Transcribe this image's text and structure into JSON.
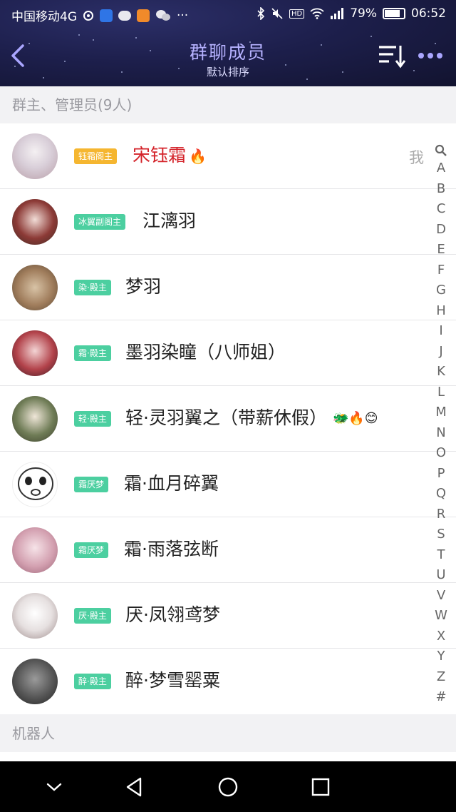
{
  "status": {
    "carrier": "中国移动4G",
    "battery": "79%",
    "battery_level": 0.79,
    "time": "06:52",
    "more": "···"
  },
  "header": {
    "title": "群聊成员",
    "subtitle": "默认排序"
  },
  "sections": {
    "admins": "群主、管理员(9人)",
    "robots": "机器人"
  },
  "members": [
    {
      "badge": "钰霜阁主",
      "badge_color": "#f5b630",
      "name": "宋钰霜",
      "name_color": "#d4232a",
      "emoji": "🔥",
      "me_label": "我"
    },
    {
      "badge": "冰翼副阁主",
      "badge_color": "#4ccfa0",
      "name": "江漓羽"
    },
    {
      "badge": "染·殿主",
      "badge_color": "#4ccfa0",
      "name": "梦羽"
    },
    {
      "badge": "霜·殿主",
      "badge_color": "#4ccfa0",
      "name": "墨羽染瞳（八师姐）"
    },
    {
      "badge": "轻·殿主",
      "badge_color": "#4ccfa0",
      "name": "轻·灵羽翼之（带薪休假）",
      "emoji": "🐲🔥😊"
    },
    {
      "badge": "霜厌梦",
      "badge_color": "#4ccfa0",
      "name": "霜·血月碎翼"
    },
    {
      "badge": "霜厌梦",
      "badge_color": "#4ccfa0",
      "name": "霜·雨落弦断"
    },
    {
      "badge": "厌·殿主",
      "badge_color": "#4ccfa0",
      "name": "厌·凤翎鸢梦"
    },
    {
      "badge": "醉·殿主",
      "badge_color": "#4ccfa0",
      "name": "醉·梦雪罂粟"
    }
  ],
  "index_letters": [
    "A",
    "B",
    "C",
    "D",
    "E",
    "F",
    "G",
    "H",
    "I",
    "J",
    "K",
    "L",
    "M",
    "N",
    "O",
    "P",
    "Q",
    "R",
    "S",
    "T",
    "U",
    "V",
    "W",
    "X",
    "Y",
    "Z",
    "#"
  ],
  "icons": {
    "back": "chevron-left-icon",
    "sort": "sort-icon",
    "more": "more-icon",
    "index_search": "search-icon"
  },
  "colors": {
    "header_bg": "#1d1f4c",
    "title": "#b6b2ff",
    "owner_name": "#d4232a",
    "gold_badge": "#f5b630",
    "green_badge": "#4ccfa0"
  }
}
